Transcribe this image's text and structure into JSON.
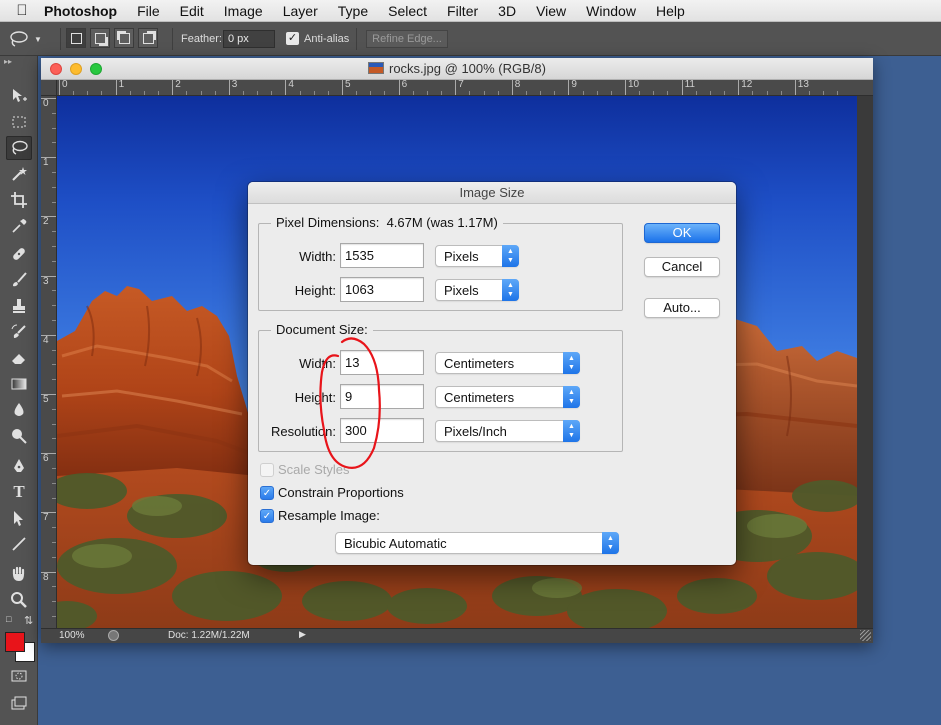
{
  "menubar": {
    "app": "Photoshop",
    "items": [
      "File",
      "Edit",
      "Image",
      "Layer",
      "Type",
      "Select",
      "Filter",
      "3D",
      "View",
      "Window",
      "Help"
    ]
  },
  "options": {
    "feather_label": "Feather:",
    "feather_value": "0 px",
    "antialias_label": "Anti-alias",
    "antialias_checked": true,
    "refine_label": "Refine Edge..."
  },
  "document": {
    "title": "rocks.jpg @ 100% (RGB/8)",
    "hruler_labels": [
      "0",
      "1",
      "2",
      "3",
      "4",
      "5",
      "6",
      "7",
      "8",
      "9",
      "10",
      "11",
      "12",
      "13"
    ],
    "vruler_labels": [
      "0",
      "1",
      "2",
      "3",
      "4",
      "5",
      "6",
      "7",
      "8"
    ],
    "zoom": "100%",
    "doc_info": "Doc: 1.22M/1.22M"
  },
  "colors": {
    "foreground": "#e8141a",
    "background": "#ffffff",
    "accent": "#1e74e8"
  },
  "dialog": {
    "title": "Image Size",
    "pixel_dimensions": {
      "legend": "Pixel Dimensions:",
      "size_text": "4.67M (was 1.17M)",
      "width_label": "Width:",
      "width_value": "1535",
      "width_unit": "Pixels",
      "height_label": "Height:",
      "height_value": "1063",
      "height_unit": "Pixels"
    },
    "document_size": {
      "legend": "Document Size:",
      "width_label": "Width:",
      "width_value": "13",
      "width_unit": "Centimeters",
      "height_label": "Height:",
      "height_value": "9",
      "height_unit": "Centimeters",
      "resolution_label": "Resolution:",
      "resolution_value": "300",
      "resolution_unit": "Pixels/Inch"
    },
    "scale_styles": {
      "label": "Scale Styles",
      "checked": false,
      "enabled": false
    },
    "constrain": {
      "label": "Constrain Proportions",
      "checked": true
    },
    "resample": {
      "label": "Resample Image:",
      "checked": true
    },
    "resample_method": "Bicubic Automatic",
    "buttons": {
      "ok": "OK",
      "cancel": "Cancel",
      "auto": "Auto..."
    }
  }
}
